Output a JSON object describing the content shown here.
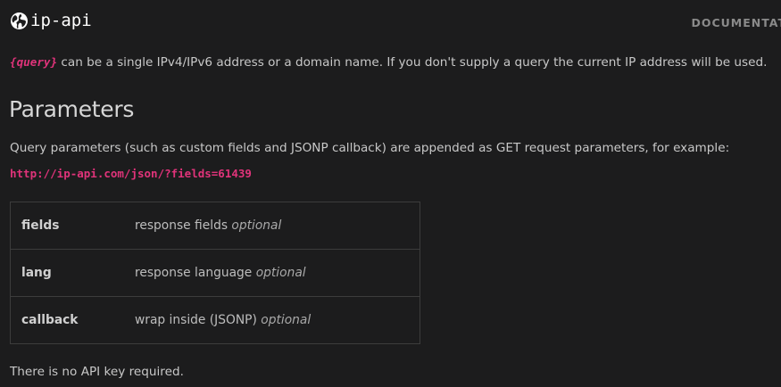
{
  "header": {
    "logo_text": "ip-api",
    "logo_icon": "globe-icon",
    "nav_documentation": "DOCUMENTAT"
  },
  "intro": {
    "query_tag": "{query}",
    "text": " can be a single IPv4/IPv6 address or a domain name. If you don't supply a query the current IP address will be used."
  },
  "parameters": {
    "title": "Parameters",
    "description": "Query parameters (such as custom fields and JSONP callback) are appended as GET request parameters, for example:",
    "example_url": "http://ip-api.com/json/?fields=61439",
    "rows": [
      {
        "name": "fields",
        "description": "response fields",
        "flag": "optional"
      },
      {
        "name": "lang",
        "description": "response language",
        "flag": "optional"
      },
      {
        "name": "callback",
        "description": "wrap inside (JSONP)",
        "flag": "optional"
      }
    ]
  },
  "footer_note": "There is no API key required.",
  "colors": {
    "background": "#1c1c1d",
    "accent": "#e0337a",
    "text": "#c8c8c8"
  }
}
